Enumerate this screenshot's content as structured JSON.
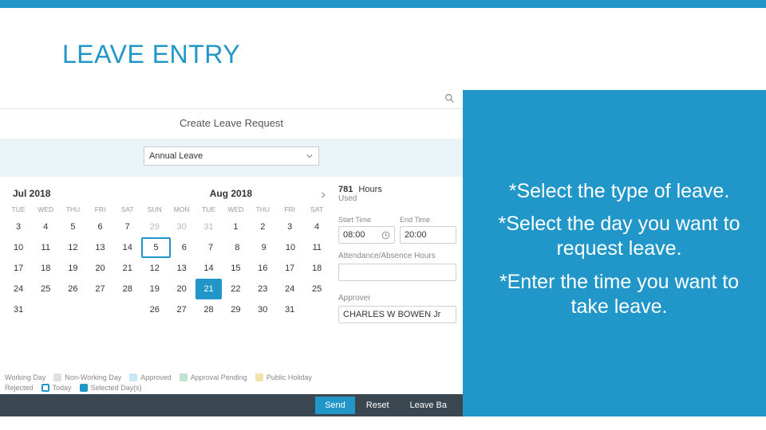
{
  "title": "LEAVE ENTRY",
  "instructions": [
    "*Select the type of leave.",
    "*Select the day you want to request leave.",
    "*Enter the time you want to take leave."
  ],
  "app": {
    "header": "Create Leave Request",
    "leave_type": "Annual Leave",
    "months": {
      "left": {
        "label": "Jul 2018",
        "dow": [
          "TUE",
          "WED",
          "THU",
          "FRI",
          "SAT"
        ],
        "weeks": [
          [
            "3",
            "4",
            "5",
            "6",
            "7"
          ],
          [
            "10",
            "11",
            "12",
            "13",
            "14"
          ],
          [
            "17",
            "18",
            "19",
            "20",
            "21"
          ],
          [
            "24",
            "25",
            "26",
            "27",
            "28"
          ],
          [
            "31",
            "",
            "",
            "",
            ""
          ]
        ]
      },
      "right": {
        "label": "Aug 2018",
        "dow": [
          "SUN",
          "MON",
          "TUE",
          "WED",
          "THU",
          "FRI",
          "SAT"
        ],
        "weeks": [
          [
            "29",
            "30",
            "31",
            "1",
            "2",
            "3",
            "4"
          ],
          [
            "5",
            "6",
            "7",
            "8",
            "9",
            "10",
            "11"
          ],
          [
            "12",
            "13",
            "14",
            "15",
            "16",
            "17",
            "18"
          ],
          [
            "19",
            "20",
            "21",
            "22",
            "23",
            "24",
            "25"
          ],
          [
            "26",
            "27",
            "28",
            "29",
            "30",
            "31",
            ""
          ]
        ],
        "muted_first_row": 3,
        "today": "5",
        "selected": "21"
      }
    },
    "hours": {
      "value": "781",
      "unit": "Hours",
      "sub": "Used"
    },
    "start_time": {
      "label": "Start Time",
      "value": "08:00"
    },
    "end_time": {
      "label": "End Time",
      "value": "20:00"
    },
    "attendance_label": "Attendance/Absence Hours",
    "attendance_value": "",
    "approver_label": "Approver",
    "approver_value": "CHARLES W BOWEN Jr",
    "legend": {
      "working_day": "Working Day",
      "non_working": "Non-Working Day",
      "approved": "Approved",
      "pending": "Approval Pending",
      "holiday": "Public Holiday",
      "rejected": "Rejected",
      "today": "Today",
      "selected": "Selected Day(s)"
    },
    "colors": {
      "non_working": "#e0e0e0",
      "approved": "#c8e6f5",
      "pending": "#bfe3d0",
      "holiday": "#f3e2a9",
      "today": "#2196c9",
      "selected": "#2196c9"
    },
    "buttons": {
      "send": "Send",
      "reset": "Reset",
      "balances": "Leave Ba"
    }
  }
}
